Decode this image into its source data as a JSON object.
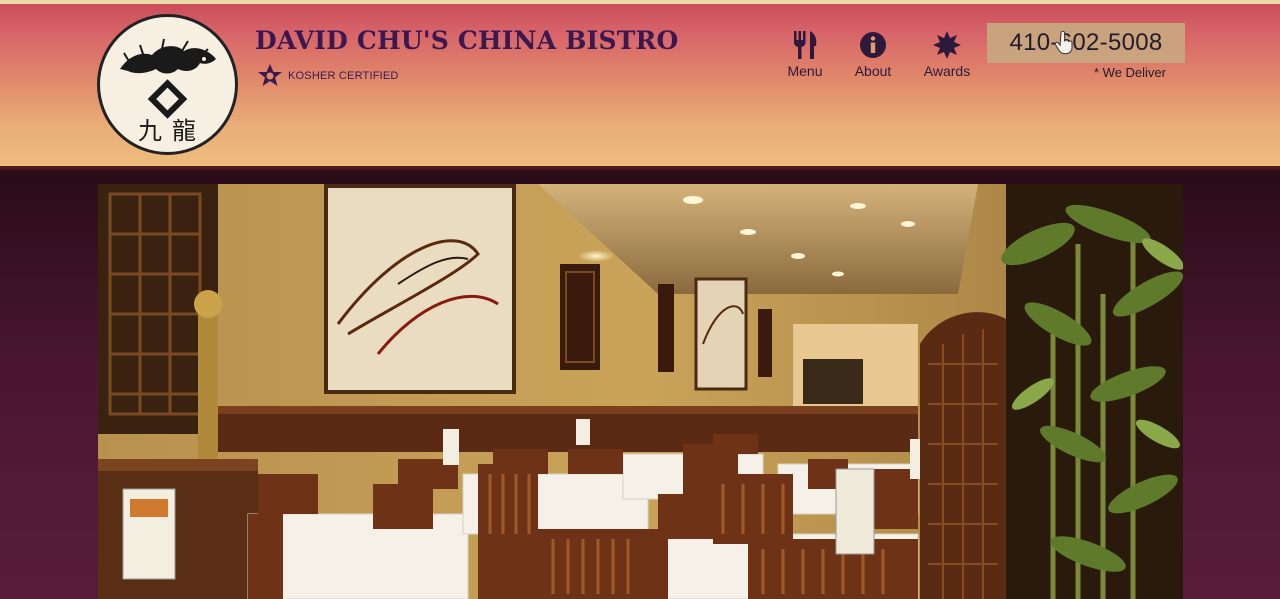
{
  "header": {
    "logo_name": "david-chus-dragon-logo",
    "title": "DAVID CHU'S CHINA BISTRO",
    "certification": "KOSHER CERTIFIED"
  },
  "nav": {
    "items": [
      {
        "label": "Menu",
        "icon": "fork-knife-icon"
      },
      {
        "label": "About",
        "icon": "info-icon"
      },
      {
        "label": "Awards",
        "icon": "award-badge-icon"
      }
    ]
  },
  "contact": {
    "phone": "410-602-5008",
    "delivery_note": "* We Deliver"
  },
  "hero": {
    "image_subject": "restaurant-dining-room-photo"
  },
  "colors": {
    "title": "#3a1850",
    "phone_bg": "#c9a27e",
    "header_top": "#c94e5a",
    "header_bottom": "#eebd7d",
    "band": "#4a1632"
  }
}
